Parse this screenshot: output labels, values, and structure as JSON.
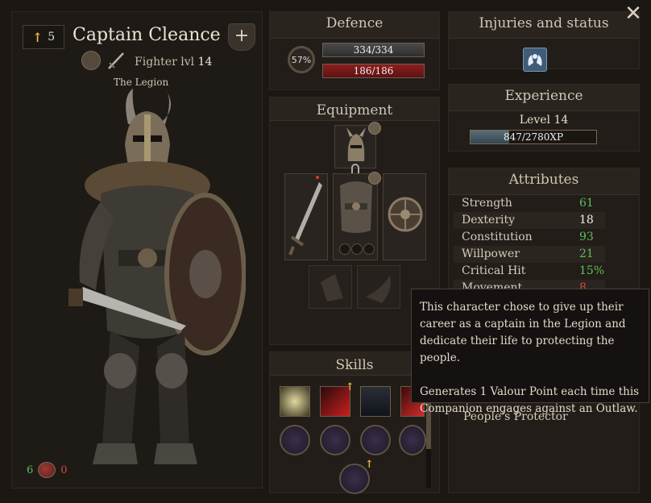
{
  "character": {
    "rank": "5",
    "name": "Captain Cleance",
    "class_label": "Fighter lvl",
    "level": "14",
    "faction": "The Legion",
    "plus": "+",
    "good_count": "6",
    "bad_count": "0",
    "icons": [
      "rank-up-arrow-icon",
      "shield-class-icon",
      "sword-class-icon",
      "plus-shield-icon",
      "morality-mask-icon"
    ]
  },
  "defence": {
    "title": "Defence",
    "percent": "57%",
    "armor": "334/334",
    "health": "186/186"
  },
  "equipment": {
    "title": "Equipment",
    "slots": [
      "helmet",
      "weapon",
      "body-armor",
      "shield",
      "empty-slot",
      "empty-slot"
    ]
  },
  "skills": {
    "title": "Skills",
    "icons": [
      "tri-blade-skill-icon",
      "red-strike-skill-icon",
      "guardian-skill-icon",
      "red-slash-skill-icon",
      "cross-slash-skill-icon",
      "spin-skill-icon",
      "swirl-skill-icon",
      "lightning-skill-icon",
      "purple-orb-skill-icon"
    ],
    "upgradeable": [
      1,
      3,
      8
    ]
  },
  "injuries": {
    "title": "Injuries and status",
    "icon": "protective-hands-status-icon"
  },
  "experience": {
    "title": "Experience",
    "level_text": "Level 14",
    "xp_text": "847/2780XP",
    "xp_fraction": 0.305
  },
  "attributes": {
    "title": "Attributes",
    "rows": [
      {
        "label": "Strength",
        "value": "61",
        "color": "#5fbf5a"
      },
      {
        "label": "Dexterity",
        "value": "18",
        "color": "#f2ebdc"
      },
      {
        "label": "Constitution",
        "value": "93",
        "color": "#5fbf5a"
      },
      {
        "label": "Willpower",
        "value": "21",
        "color": "#5fbf5a"
      },
      {
        "label": "Critical Hit",
        "value": "15%",
        "color": "#5fbf5a"
      },
      {
        "label": "Movement",
        "value": "8",
        "color": "#d14a3a"
      }
    ],
    "trait": "People's Protector"
  },
  "tooltip": {
    "paragraph1": "This character chose to give up their career as a captain in the Legion and dedicate their life to protecting the people.",
    "paragraph2": "Generates 1 Valour Point each time this Companion engages against an Outlaw."
  },
  "close_label": "✕"
}
